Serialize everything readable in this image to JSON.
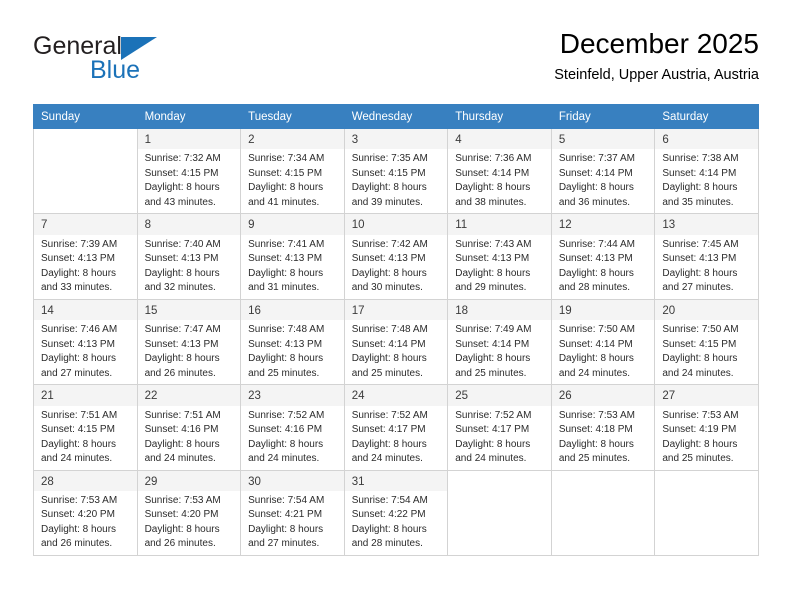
{
  "brand": {
    "name_part1": "General",
    "name_part2": "Blue"
  },
  "header": {
    "title": "December 2025",
    "subtitle": "Steinfeld, Upper Austria, Austria"
  },
  "colors": {
    "header_blue": "#3880c0",
    "brand_blue": "#1b72b8",
    "row_shade": "#f4f4f4",
    "grid_line": "#d3d3d3"
  },
  "weekday_headers": [
    "Sunday",
    "Monday",
    "Tuesday",
    "Wednesday",
    "Thursday",
    "Friday",
    "Saturday"
  ],
  "weeks": [
    [
      {
        "day": "",
        "sunrise": "",
        "sunset": "",
        "daylight_line1": "",
        "daylight_line2": ""
      },
      {
        "day": "1",
        "sunrise": "Sunrise: 7:32 AM",
        "sunset": "Sunset: 4:15 PM",
        "daylight_line1": "Daylight: 8 hours",
        "daylight_line2": "and 43 minutes."
      },
      {
        "day": "2",
        "sunrise": "Sunrise: 7:34 AM",
        "sunset": "Sunset: 4:15 PM",
        "daylight_line1": "Daylight: 8 hours",
        "daylight_line2": "and 41 minutes."
      },
      {
        "day": "3",
        "sunrise": "Sunrise: 7:35 AM",
        "sunset": "Sunset: 4:15 PM",
        "daylight_line1": "Daylight: 8 hours",
        "daylight_line2": "and 39 minutes."
      },
      {
        "day": "4",
        "sunrise": "Sunrise: 7:36 AM",
        "sunset": "Sunset: 4:14 PM",
        "daylight_line1": "Daylight: 8 hours",
        "daylight_line2": "and 38 minutes."
      },
      {
        "day": "5",
        "sunrise": "Sunrise: 7:37 AM",
        "sunset": "Sunset: 4:14 PM",
        "daylight_line1": "Daylight: 8 hours",
        "daylight_line2": "and 36 minutes."
      },
      {
        "day": "6",
        "sunrise": "Sunrise: 7:38 AM",
        "sunset": "Sunset: 4:14 PM",
        "daylight_line1": "Daylight: 8 hours",
        "daylight_line2": "and 35 minutes."
      }
    ],
    [
      {
        "day": "7",
        "sunrise": "Sunrise: 7:39 AM",
        "sunset": "Sunset: 4:13 PM",
        "daylight_line1": "Daylight: 8 hours",
        "daylight_line2": "and 33 minutes."
      },
      {
        "day": "8",
        "sunrise": "Sunrise: 7:40 AM",
        "sunset": "Sunset: 4:13 PM",
        "daylight_line1": "Daylight: 8 hours",
        "daylight_line2": "and 32 minutes."
      },
      {
        "day": "9",
        "sunrise": "Sunrise: 7:41 AM",
        "sunset": "Sunset: 4:13 PM",
        "daylight_line1": "Daylight: 8 hours",
        "daylight_line2": "and 31 minutes."
      },
      {
        "day": "10",
        "sunrise": "Sunrise: 7:42 AM",
        "sunset": "Sunset: 4:13 PM",
        "daylight_line1": "Daylight: 8 hours",
        "daylight_line2": "and 30 minutes."
      },
      {
        "day": "11",
        "sunrise": "Sunrise: 7:43 AM",
        "sunset": "Sunset: 4:13 PM",
        "daylight_line1": "Daylight: 8 hours",
        "daylight_line2": "and 29 minutes."
      },
      {
        "day": "12",
        "sunrise": "Sunrise: 7:44 AM",
        "sunset": "Sunset: 4:13 PM",
        "daylight_line1": "Daylight: 8 hours",
        "daylight_line2": "and 28 minutes."
      },
      {
        "day": "13",
        "sunrise": "Sunrise: 7:45 AM",
        "sunset": "Sunset: 4:13 PM",
        "daylight_line1": "Daylight: 8 hours",
        "daylight_line2": "and 27 minutes."
      }
    ],
    [
      {
        "day": "14",
        "sunrise": "Sunrise: 7:46 AM",
        "sunset": "Sunset: 4:13 PM",
        "daylight_line1": "Daylight: 8 hours",
        "daylight_line2": "and 27 minutes."
      },
      {
        "day": "15",
        "sunrise": "Sunrise: 7:47 AM",
        "sunset": "Sunset: 4:13 PM",
        "daylight_line1": "Daylight: 8 hours",
        "daylight_line2": "and 26 minutes."
      },
      {
        "day": "16",
        "sunrise": "Sunrise: 7:48 AM",
        "sunset": "Sunset: 4:13 PM",
        "daylight_line1": "Daylight: 8 hours",
        "daylight_line2": "and 25 minutes."
      },
      {
        "day": "17",
        "sunrise": "Sunrise: 7:48 AM",
        "sunset": "Sunset: 4:14 PM",
        "daylight_line1": "Daylight: 8 hours",
        "daylight_line2": "and 25 minutes."
      },
      {
        "day": "18",
        "sunrise": "Sunrise: 7:49 AM",
        "sunset": "Sunset: 4:14 PM",
        "daylight_line1": "Daylight: 8 hours",
        "daylight_line2": "and 25 minutes."
      },
      {
        "day": "19",
        "sunrise": "Sunrise: 7:50 AM",
        "sunset": "Sunset: 4:14 PM",
        "daylight_line1": "Daylight: 8 hours",
        "daylight_line2": "and 24 minutes."
      },
      {
        "day": "20",
        "sunrise": "Sunrise: 7:50 AM",
        "sunset": "Sunset: 4:15 PM",
        "daylight_line1": "Daylight: 8 hours",
        "daylight_line2": "and 24 minutes."
      }
    ],
    [
      {
        "day": "21",
        "sunrise": "Sunrise: 7:51 AM",
        "sunset": "Sunset: 4:15 PM",
        "daylight_line1": "Daylight: 8 hours",
        "daylight_line2": "and 24 minutes."
      },
      {
        "day": "22",
        "sunrise": "Sunrise: 7:51 AM",
        "sunset": "Sunset: 4:16 PM",
        "daylight_line1": "Daylight: 8 hours",
        "daylight_line2": "and 24 minutes."
      },
      {
        "day": "23",
        "sunrise": "Sunrise: 7:52 AM",
        "sunset": "Sunset: 4:16 PM",
        "daylight_line1": "Daylight: 8 hours",
        "daylight_line2": "and 24 minutes."
      },
      {
        "day": "24",
        "sunrise": "Sunrise: 7:52 AM",
        "sunset": "Sunset: 4:17 PM",
        "daylight_line1": "Daylight: 8 hours",
        "daylight_line2": "and 24 minutes."
      },
      {
        "day": "25",
        "sunrise": "Sunrise: 7:52 AM",
        "sunset": "Sunset: 4:17 PM",
        "daylight_line1": "Daylight: 8 hours",
        "daylight_line2": "and 24 minutes."
      },
      {
        "day": "26",
        "sunrise": "Sunrise: 7:53 AM",
        "sunset": "Sunset: 4:18 PM",
        "daylight_line1": "Daylight: 8 hours",
        "daylight_line2": "and 25 minutes."
      },
      {
        "day": "27",
        "sunrise": "Sunrise: 7:53 AM",
        "sunset": "Sunset: 4:19 PM",
        "daylight_line1": "Daylight: 8 hours",
        "daylight_line2": "and 25 minutes."
      }
    ],
    [
      {
        "day": "28",
        "sunrise": "Sunrise: 7:53 AM",
        "sunset": "Sunset: 4:20 PM",
        "daylight_line1": "Daylight: 8 hours",
        "daylight_line2": "and 26 minutes."
      },
      {
        "day": "29",
        "sunrise": "Sunrise: 7:53 AM",
        "sunset": "Sunset: 4:20 PM",
        "daylight_line1": "Daylight: 8 hours",
        "daylight_line2": "and 26 minutes."
      },
      {
        "day": "30",
        "sunrise": "Sunrise: 7:54 AM",
        "sunset": "Sunset: 4:21 PM",
        "daylight_line1": "Daylight: 8 hours",
        "daylight_line2": "and 27 minutes."
      },
      {
        "day": "31",
        "sunrise": "Sunrise: 7:54 AM",
        "sunset": "Sunset: 4:22 PM",
        "daylight_line1": "Daylight: 8 hours",
        "daylight_line2": "and 28 minutes."
      },
      {
        "day": "",
        "sunrise": "",
        "sunset": "",
        "daylight_line1": "",
        "daylight_line2": ""
      },
      {
        "day": "",
        "sunrise": "",
        "sunset": "",
        "daylight_line1": "",
        "daylight_line2": ""
      },
      {
        "day": "",
        "sunrise": "",
        "sunset": "",
        "daylight_line1": "",
        "daylight_line2": ""
      }
    ]
  ]
}
